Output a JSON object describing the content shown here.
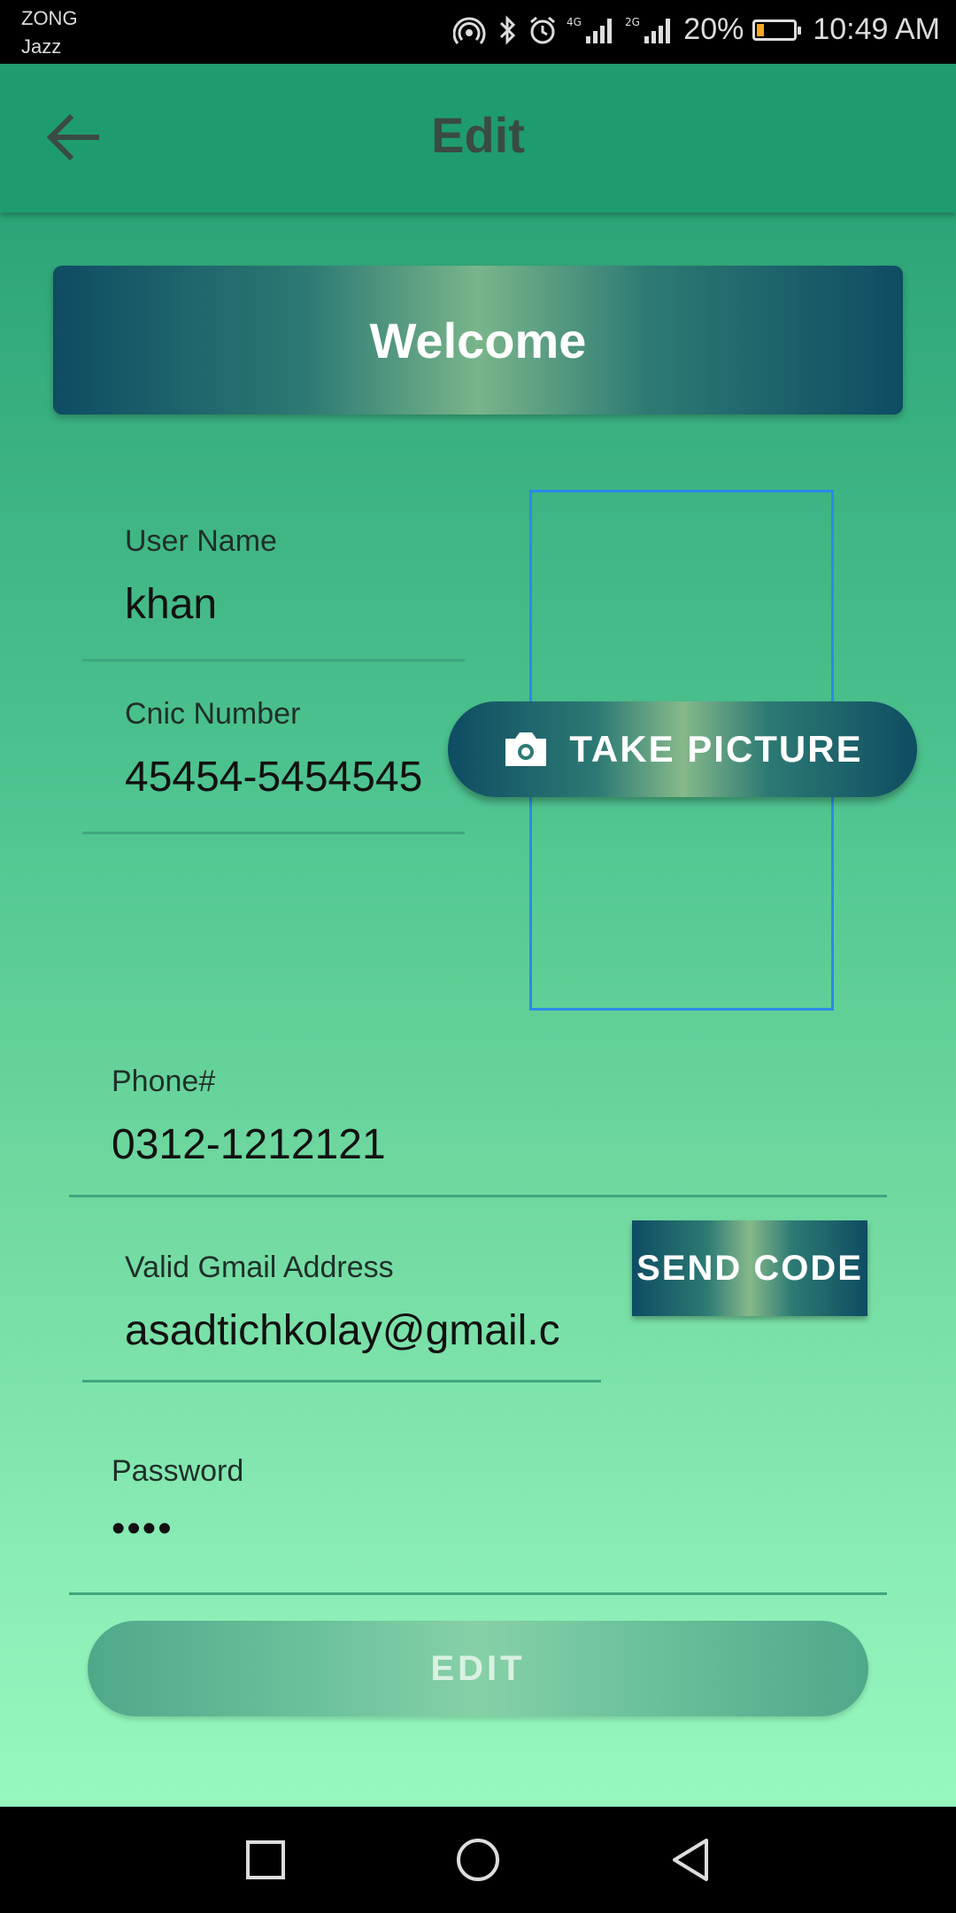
{
  "status_bar": {
    "carrier_primary": "ZONG",
    "carrier_secondary": "Jazz",
    "battery_percent": "20%",
    "battery_level": 0.2,
    "time": "10:49 AM",
    "icons": [
      "hotspot-icon",
      "bluetooth-icon",
      "alarm-icon",
      "signal-4g-icon",
      "signal-2g-icon",
      "battery-icon"
    ]
  },
  "app_bar": {
    "title": "Edit",
    "back_icon": "arrow-left-icon"
  },
  "banner": {
    "text": "Welcome"
  },
  "form": {
    "user_name": {
      "label": "User Name",
      "value": "khan"
    },
    "cnic": {
      "label": "Cnic Number",
      "value": "45454-5454545"
    },
    "phone": {
      "label": "Phone#",
      "value": "0312-1212121"
    },
    "email": {
      "label": "Valid Gmail Address",
      "value": "asadtichkolay@gmail.c"
    },
    "password": {
      "label": "Password",
      "value": "••••"
    }
  },
  "buttons": {
    "take_picture": "TAKE PICTURE",
    "send_code": "SEND CODE",
    "edit": "EDIT"
  },
  "colors": {
    "app_bar": "#1f9c6e",
    "gradient_dark": "#0e4c62",
    "gradient_light": "#79b58a",
    "photo_frame": "#2a8ae8"
  },
  "nav_bar": {
    "icons": [
      "recent-apps-icon",
      "home-icon",
      "back-nav-icon"
    ]
  }
}
